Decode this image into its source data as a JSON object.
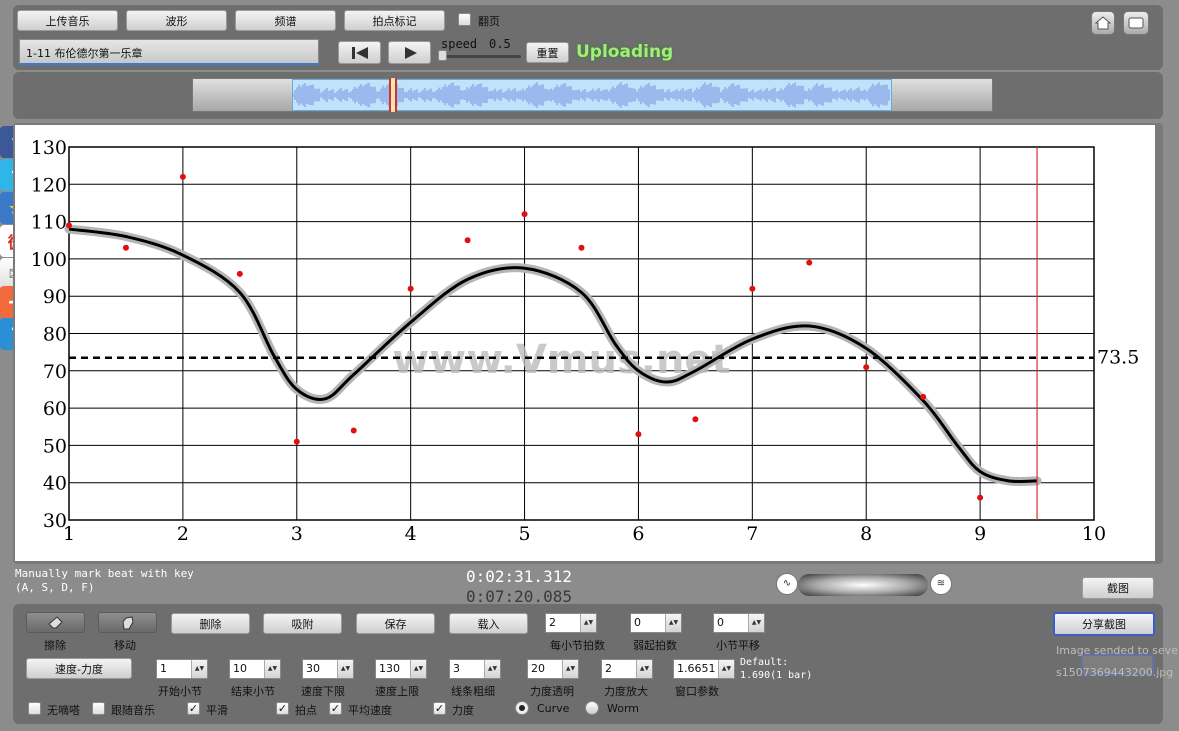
{
  "toolbar": {
    "upload_music": "上传音乐",
    "waveform": "波形",
    "spectrum": "频谱",
    "beat_mark": "拍点标记",
    "page_turn_label": "翻页",
    "page_turn_checked": false,
    "track_title": "1-11 布伦德尔第一乐章",
    "speed_label": "speed",
    "speed_value": "0.5",
    "reset": "重置",
    "status": "Uploading"
  },
  "icons": {
    "home": "home-icon",
    "screen": "screen-icon",
    "prev": "skip-back-icon",
    "play": "play-icon",
    "eraser": "eraser-icon",
    "move": "hand-icon"
  },
  "social": [
    "facebook",
    "twitter",
    "favorite",
    "weibo",
    "mail",
    "add",
    "help"
  ],
  "watermark": "www.Vmus.net",
  "info": {
    "hint_line1": "Manually mark beat with key",
    "hint_line2": "(A, S, D, F)",
    "time_current": "0:02:31.312",
    "time_total": "0:07:20.085",
    "screenshot": "截图",
    "share_screenshot": "分享截图",
    "sent_text": "Image sended to sever",
    "file_text": "s1507369443200.jpg"
  },
  "controls": {
    "erase": "擦除",
    "move": "移动",
    "delete": "删除",
    "attach": "吸附",
    "save": "保存",
    "load": "载入",
    "beats_per_bar": {
      "value": "2",
      "label": "每小节拍数"
    },
    "pickup_beats": {
      "value": "0",
      "label": "弱起拍数"
    },
    "bar_shift": {
      "value": "0",
      "label": "小节平移"
    },
    "mode": "速度-力度",
    "start_bar": {
      "value": "1",
      "label": "开始小节"
    },
    "end_bar": {
      "value": "10",
      "label": "结束小节"
    },
    "tempo_min": {
      "value": "30",
      "label": "速度下限"
    },
    "tempo_max": {
      "value": "130",
      "label": "速度上限"
    },
    "line_width": {
      "value": "3",
      "label": "线条粗细"
    },
    "dyn_opacity": {
      "value": "20",
      "label": "力度透明"
    },
    "dyn_zoom": {
      "value": "2",
      "label": "力度放大"
    },
    "window_param": {
      "value": "1.6651",
      "label": "窗口参数"
    },
    "default_line1": "Default:",
    "default_line2": "1.690(1 bar)",
    "no_metronome": {
      "label": "无嘀嗒",
      "checked": false
    },
    "follow_music": {
      "label": "跟随音乐",
      "checked": false
    },
    "smooth": {
      "label": "平滑",
      "checked": true
    },
    "beat_points": {
      "label": "拍点",
      "checked": true
    },
    "avg_tempo": {
      "label": "平均速度",
      "checked": true
    },
    "dynamics": {
      "label": "力度",
      "checked": true
    },
    "curve": {
      "label": "Curve",
      "selected": true
    },
    "worm": {
      "label": "Worm",
      "selected": false
    }
  },
  "chart_data": {
    "type": "line",
    "xlim": [
      1,
      10
    ],
    "ylim": [
      30,
      130
    ],
    "x_ticks": [
      "1",
      "2",
      "3",
      "4",
      "5",
      "6",
      "7",
      "8",
      "9",
      "10"
    ],
    "y_ticks": [
      "30",
      "40",
      "50",
      "60",
      "70",
      "80",
      "90",
      "100",
      "110",
      "120",
      "130"
    ],
    "average_tempo": 73.5,
    "average_label": "73.5",
    "playhead_x": 9.5,
    "grid": true,
    "beat_points": [
      {
        "x": 1.0,
        "y": 109
      },
      {
        "x": 1.5,
        "y": 103
      },
      {
        "x": 2.0,
        "y": 122
      },
      {
        "x": 2.5,
        "y": 96
      },
      {
        "x": 3.0,
        "y": 51
      },
      {
        "x": 3.5,
        "y": 54
      },
      {
        "x": 4.0,
        "y": 92
      },
      {
        "x": 4.5,
        "y": 105
      },
      {
        "x": 5.0,
        "y": 112
      },
      {
        "x": 5.5,
        "y": 103
      },
      {
        "x": 6.0,
        "y": 53
      },
      {
        "x": 6.5,
        "y": 57
      },
      {
        "x": 7.0,
        "y": 92
      },
      {
        "x": 7.5,
        "y": 99
      },
      {
        "x": 8.0,
        "y": 71
      },
      {
        "x": 8.5,
        "y": 63
      },
      {
        "x": 9.0,
        "y": 36
      }
    ],
    "tempo_curve": [
      [
        1.0,
        108
      ],
      [
        1.5,
        106
      ],
      [
        2.0,
        101
      ],
      [
        2.5,
        91
      ],
      [
        2.8,
        74
      ],
      [
        3.0,
        65
      ],
      [
        3.25,
        62.5
      ],
      [
        3.5,
        69
      ],
      [
        4.0,
        83
      ],
      [
        4.5,
        94.5
      ],
      [
        5.0,
        97.5
      ],
      [
        5.5,
        91
      ],
      [
        5.8,
        77
      ],
      [
        6.0,
        70
      ],
      [
        6.25,
        67
      ],
      [
        6.5,
        70
      ],
      [
        7.0,
        78.5
      ],
      [
        7.5,
        82
      ],
      [
        8.0,
        76
      ],
      [
        8.5,
        62
      ],
      [
        8.8,
        50
      ],
      [
        9.0,
        43
      ],
      [
        9.25,
        40.5
      ],
      [
        9.5,
        40.5
      ]
    ]
  }
}
